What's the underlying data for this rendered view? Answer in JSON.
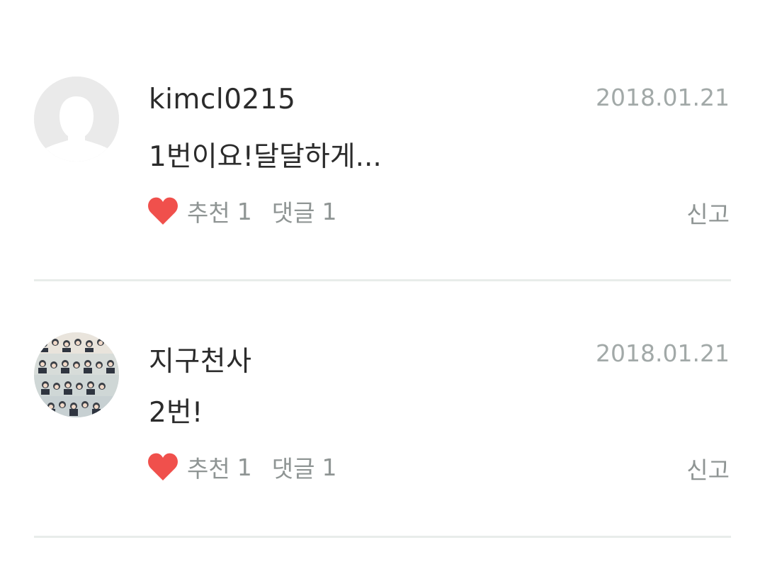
{
  "comments": [
    {
      "username": "kimcl0215",
      "date": "2018.01.21",
      "text": "1번이요!달달하게...",
      "avatar": "default-avatar",
      "like_label": "추천",
      "like_count": "1",
      "reply_label": "댓글",
      "reply_count": "1",
      "report_label": "신고"
    },
    {
      "username": "지구천사",
      "date": "2018.01.21",
      "text": "2번!",
      "avatar": "group-photo-avatar",
      "like_label": "추천",
      "like_count": "1",
      "reply_label": "댓글",
      "reply_count": "1",
      "report_label": "신고"
    }
  ],
  "colors": {
    "heart": "#f0504c",
    "divider": "#e8ecea",
    "muted_text": "#8f9594",
    "date_text": "#a2a9a8",
    "primary_text": "#2b2b2b"
  }
}
